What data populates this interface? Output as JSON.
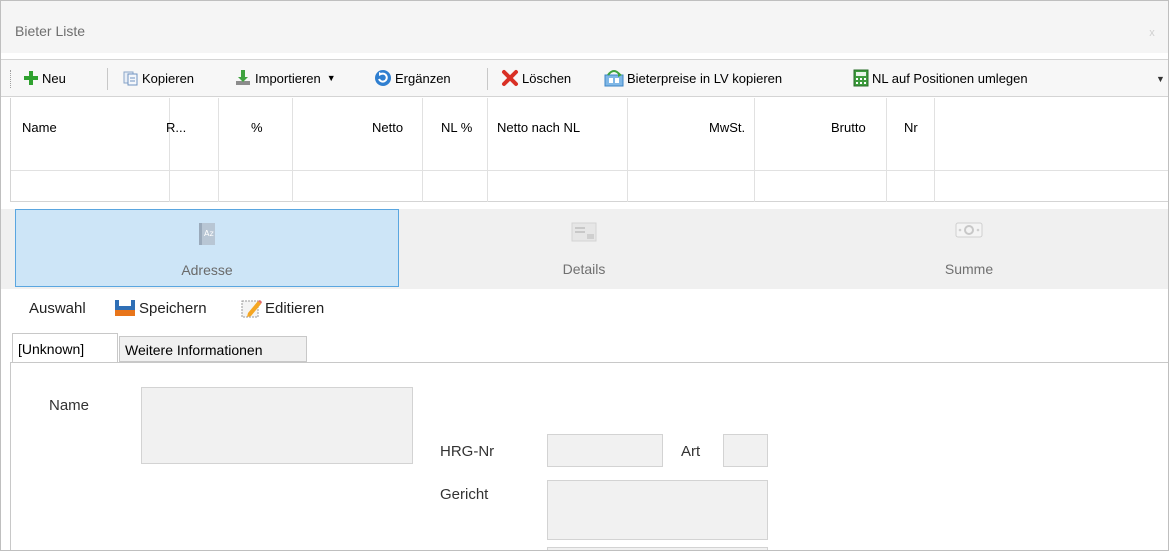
{
  "window": {
    "title": "Bieter Liste",
    "close_glyph": "x"
  },
  "toolbar": {
    "neu": "Neu",
    "kopieren": "Kopieren",
    "importieren": "Importieren",
    "ergaenzen": "Ergänzen",
    "loeschen": "Löschen",
    "bieterpreise": "Bieterpreise in LV kopieren",
    "nl_auf_positionen": "NL auf Positionen umlegen",
    "icons": {
      "neu": "plus-icon",
      "kopieren": "copy-icon",
      "importieren": "import-icon",
      "ergaenzen": "refresh-icon",
      "loeschen": "delete-icon",
      "bieterpreise": "transfer-prices-icon",
      "nl_auf_positionen": "calculator-icon"
    },
    "colors": {
      "neu": "#2fa12f",
      "loeschen": "#d93025",
      "ergaenzen": "#2f7fd0"
    }
  },
  "grid": {
    "columns": [
      "Name",
      "R...",
      "%",
      "Netto",
      "NL %",
      "Netto nach NL",
      "MwSt.",
      "Brutto",
      "Nr"
    ]
  },
  "nav": {
    "items": [
      {
        "label": "Adresse",
        "icon": "address-book-icon",
        "active": true
      },
      {
        "label": "Details",
        "icon": "details-card-icon",
        "active": false
      },
      {
        "label": "Summe",
        "icon": "money-icon",
        "active": false
      }
    ],
    "accent": "#5aa6e0",
    "active_bg": "#cde5f7"
  },
  "subtoolbar": {
    "auswahl": "Auswahl",
    "speichern": "Speichern",
    "editieren": "Editieren"
  },
  "tabs": {
    "active": "[Unknown]",
    "other": "Weitere Informationen"
  },
  "form": {
    "name_label": "Name",
    "name_value": "",
    "hrg_label": "HRG-Nr",
    "hrg_value": "",
    "art_label": "Art",
    "art_value": "",
    "gericht_label": "Gericht",
    "gericht_value": ""
  }
}
